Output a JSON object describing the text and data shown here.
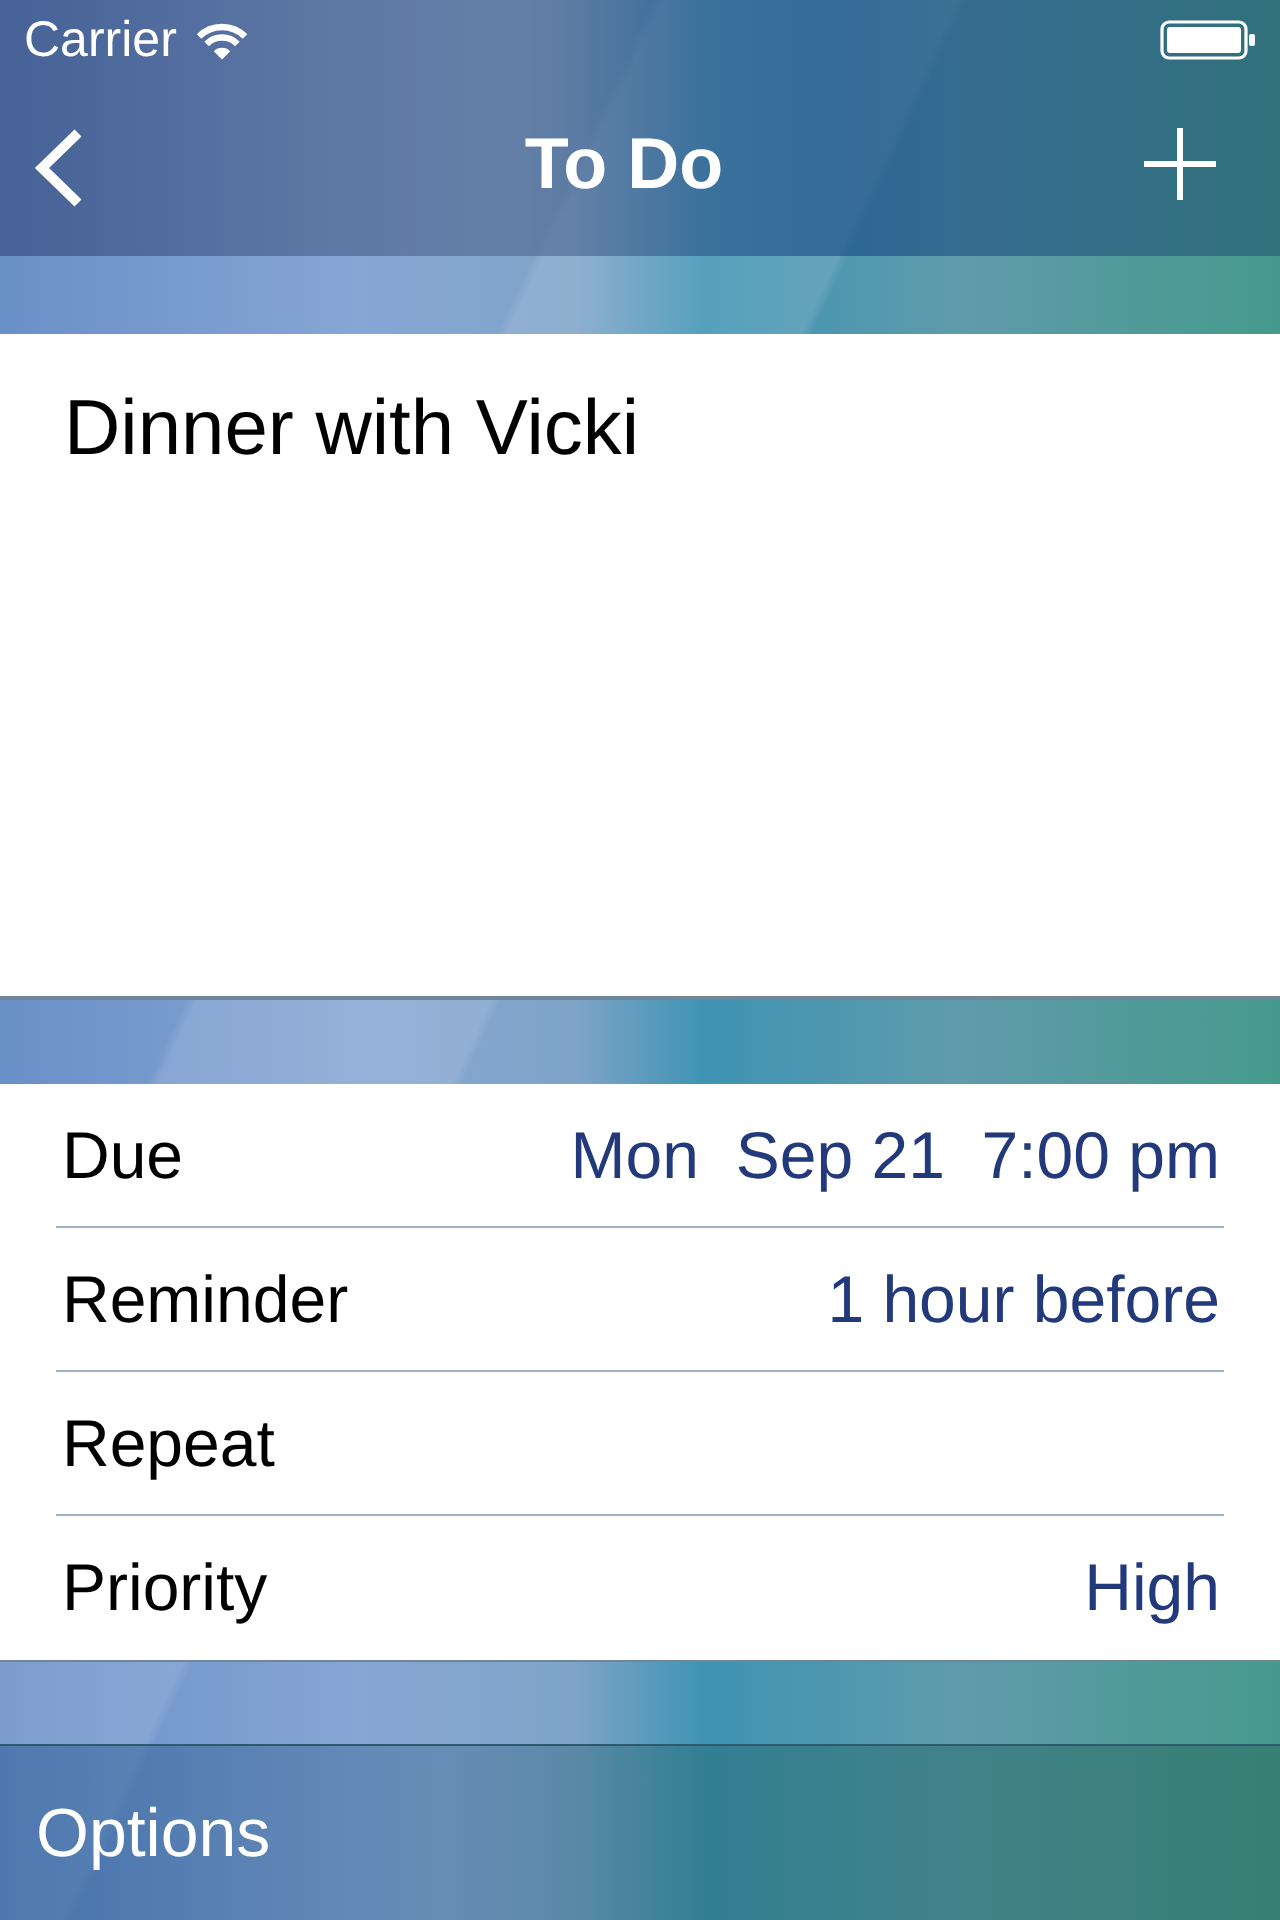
{
  "status_bar": {
    "carrier": "Carrier"
  },
  "nav_bar": {
    "title": "To Do"
  },
  "note": {
    "text": "Dinner with Vicki"
  },
  "details": [
    {
      "label": "Due",
      "value": "Mon  Sep 21  7:00 pm"
    },
    {
      "label": "Reminder",
      "value": "1 hour before"
    },
    {
      "label": "Repeat"
    },
    {
      "label": "Priority",
      "value": "High"
    }
  ],
  "toolbar": {
    "button": "Options"
  }
}
